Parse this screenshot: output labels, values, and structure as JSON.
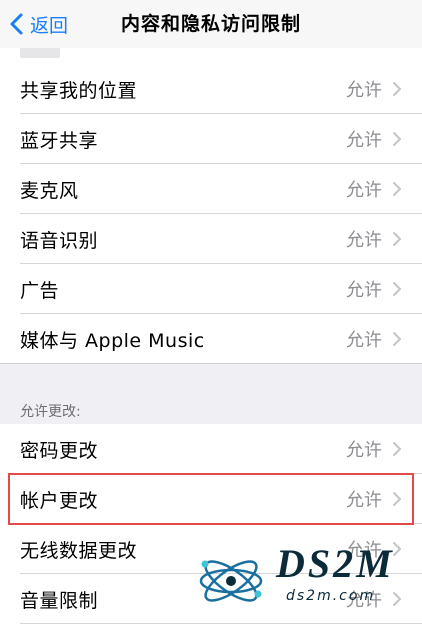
{
  "nav": {
    "back_label": "返回",
    "title": "内容和隐私访问限制"
  },
  "group1": {
    "items": [
      {
        "label": "共享我的位置",
        "value": "允许"
      },
      {
        "label": "蓝牙共享",
        "value": "允许"
      },
      {
        "label": "麦克风",
        "value": "允许"
      },
      {
        "label": "语音识别",
        "value": "允许"
      },
      {
        "label": "广告",
        "value": "允许"
      },
      {
        "label": "媒体与 Apple Music",
        "value": "允许"
      }
    ]
  },
  "section2": {
    "header": "允许更改:",
    "items": [
      {
        "label": "密码更改",
        "value": "允许"
      },
      {
        "label": "帐户更改",
        "value": "允许"
      },
      {
        "label": "无线数据更改",
        "value": "允许"
      },
      {
        "label": "音量限制",
        "value": "允许"
      }
    ]
  },
  "watermark": {
    "logo": "DS2M",
    "url": "ds2m.com"
  },
  "colors": {
    "accent": "#1a7ef8",
    "highlight": "#e24a4a",
    "background": "#efeff4"
  }
}
